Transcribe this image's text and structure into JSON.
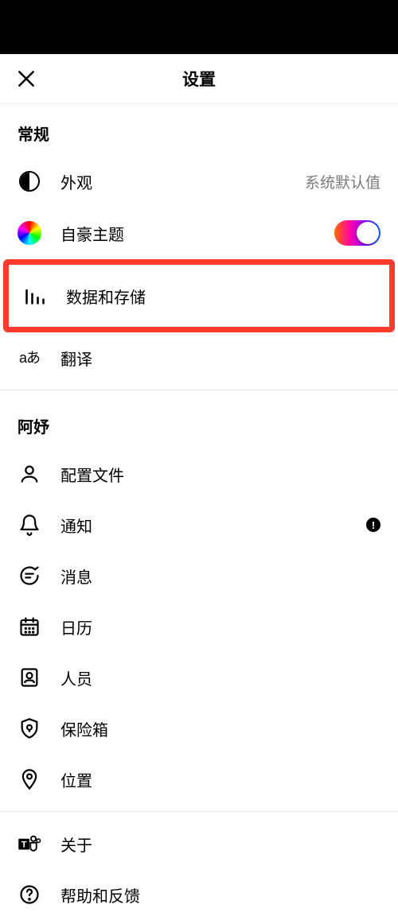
{
  "header": {
    "title": "设置"
  },
  "sections": {
    "general": {
      "title": "常规",
      "appearance": {
        "label": "外观",
        "value": "系统默认值"
      },
      "prideTheme": {
        "label": "自豪主题"
      },
      "dataStorage": {
        "label": "数据和存储"
      },
      "translate": {
        "label": "翻译"
      }
    },
    "account": {
      "title": "阿妤",
      "profile": {
        "label": "配置文件"
      },
      "notifications": {
        "label": "通知",
        "alert": "!"
      },
      "messages": {
        "label": "消息"
      },
      "calendar": {
        "label": "日历"
      },
      "people": {
        "label": "人员"
      },
      "safe": {
        "label": "保险箱"
      },
      "location": {
        "label": "位置"
      }
    },
    "footer": {
      "about": {
        "label": "关于"
      },
      "help": {
        "label": "帮助和反馈"
      }
    }
  }
}
